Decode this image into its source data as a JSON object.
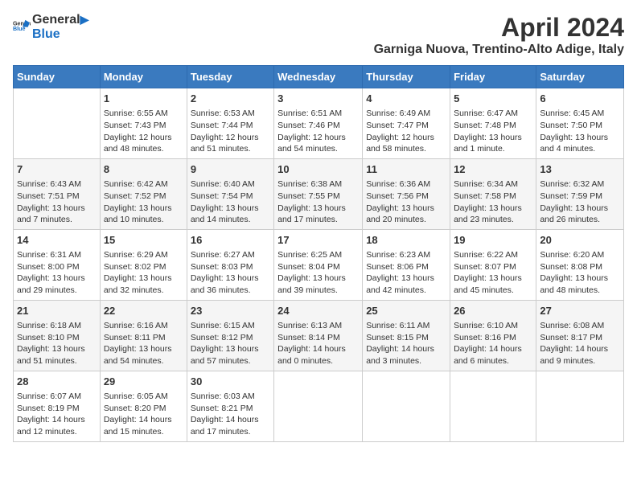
{
  "logo": {
    "general": "General",
    "blue": "Blue"
  },
  "title": "April 2024",
  "subtitle": "Garniga Nuova, Trentino-Alto Adige, Italy",
  "headers": [
    "Sunday",
    "Monday",
    "Tuesday",
    "Wednesday",
    "Thursday",
    "Friday",
    "Saturday"
  ],
  "weeks": [
    [
      {
        "day": "",
        "content": ""
      },
      {
        "day": "1",
        "content": "Sunrise: 6:55 AM\nSunset: 7:43 PM\nDaylight: 12 hours\nand 48 minutes."
      },
      {
        "day": "2",
        "content": "Sunrise: 6:53 AM\nSunset: 7:44 PM\nDaylight: 12 hours\nand 51 minutes."
      },
      {
        "day": "3",
        "content": "Sunrise: 6:51 AM\nSunset: 7:46 PM\nDaylight: 12 hours\nand 54 minutes."
      },
      {
        "day": "4",
        "content": "Sunrise: 6:49 AM\nSunset: 7:47 PM\nDaylight: 12 hours\nand 58 minutes."
      },
      {
        "day": "5",
        "content": "Sunrise: 6:47 AM\nSunset: 7:48 PM\nDaylight: 13 hours\nand 1 minute."
      },
      {
        "day": "6",
        "content": "Sunrise: 6:45 AM\nSunset: 7:50 PM\nDaylight: 13 hours\nand 4 minutes."
      }
    ],
    [
      {
        "day": "7",
        "content": "Sunrise: 6:43 AM\nSunset: 7:51 PM\nDaylight: 13 hours\nand 7 minutes."
      },
      {
        "day": "8",
        "content": "Sunrise: 6:42 AM\nSunset: 7:52 PM\nDaylight: 13 hours\nand 10 minutes."
      },
      {
        "day": "9",
        "content": "Sunrise: 6:40 AM\nSunset: 7:54 PM\nDaylight: 13 hours\nand 14 minutes."
      },
      {
        "day": "10",
        "content": "Sunrise: 6:38 AM\nSunset: 7:55 PM\nDaylight: 13 hours\nand 17 minutes."
      },
      {
        "day": "11",
        "content": "Sunrise: 6:36 AM\nSunset: 7:56 PM\nDaylight: 13 hours\nand 20 minutes."
      },
      {
        "day": "12",
        "content": "Sunrise: 6:34 AM\nSunset: 7:58 PM\nDaylight: 13 hours\nand 23 minutes."
      },
      {
        "day": "13",
        "content": "Sunrise: 6:32 AM\nSunset: 7:59 PM\nDaylight: 13 hours\nand 26 minutes."
      }
    ],
    [
      {
        "day": "14",
        "content": "Sunrise: 6:31 AM\nSunset: 8:00 PM\nDaylight: 13 hours\nand 29 minutes."
      },
      {
        "day": "15",
        "content": "Sunrise: 6:29 AM\nSunset: 8:02 PM\nDaylight: 13 hours\nand 32 minutes."
      },
      {
        "day": "16",
        "content": "Sunrise: 6:27 AM\nSunset: 8:03 PM\nDaylight: 13 hours\nand 36 minutes."
      },
      {
        "day": "17",
        "content": "Sunrise: 6:25 AM\nSunset: 8:04 PM\nDaylight: 13 hours\nand 39 minutes."
      },
      {
        "day": "18",
        "content": "Sunrise: 6:23 AM\nSunset: 8:06 PM\nDaylight: 13 hours\nand 42 minutes."
      },
      {
        "day": "19",
        "content": "Sunrise: 6:22 AM\nSunset: 8:07 PM\nDaylight: 13 hours\nand 45 minutes."
      },
      {
        "day": "20",
        "content": "Sunrise: 6:20 AM\nSunset: 8:08 PM\nDaylight: 13 hours\nand 48 minutes."
      }
    ],
    [
      {
        "day": "21",
        "content": "Sunrise: 6:18 AM\nSunset: 8:10 PM\nDaylight: 13 hours\nand 51 minutes."
      },
      {
        "day": "22",
        "content": "Sunrise: 6:16 AM\nSunset: 8:11 PM\nDaylight: 13 hours\nand 54 minutes."
      },
      {
        "day": "23",
        "content": "Sunrise: 6:15 AM\nSunset: 8:12 PM\nDaylight: 13 hours\nand 57 minutes."
      },
      {
        "day": "24",
        "content": "Sunrise: 6:13 AM\nSunset: 8:14 PM\nDaylight: 14 hours\nand 0 minutes."
      },
      {
        "day": "25",
        "content": "Sunrise: 6:11 AM\nSunset: 8:15 PM\nDaylight: 14 hours\nand 3 minutes."
      },
      {
        "day": "26",
        "content": "Sunrise: 6:10 AM\nSunset: 8:16 PM\nDaylight: 14 hours\nand 6 minutes."
      },
      {
        "day": "27",
        "content": "Sunrise: 6:08 AM\nSunset: 8:17 PM\nDaylight: 14 hours\nand 9 minutes."
      }
    ],
    [
      {
        "day": "28",
        "content": "Sunrise: 6:07 AM\nSunset: 8:19 PM\nDaylight: 14 hours\nand 12 minutes."
      },
      {
        "day": "29",
        "content": "Sunrise: 6:05 AM\nSunset: 8:20 PM\nDaylight: 14 hours\nand 15 minutes."
      },
      {
        "day": "30",
        "content": "Sunrise: 6:03 AM\nSunset: 8:21 PM\nDaylight: 14 hours\nand 17 minutes."
      },
      {
        "day": "",
        "content": ""
      },
      {
        "day": "",
        "content": ""
      },
      {
        "day": "",
        "content": ""
      },
      {
        "day": "",
        "content": ""
      }
    ]
  ]
}
